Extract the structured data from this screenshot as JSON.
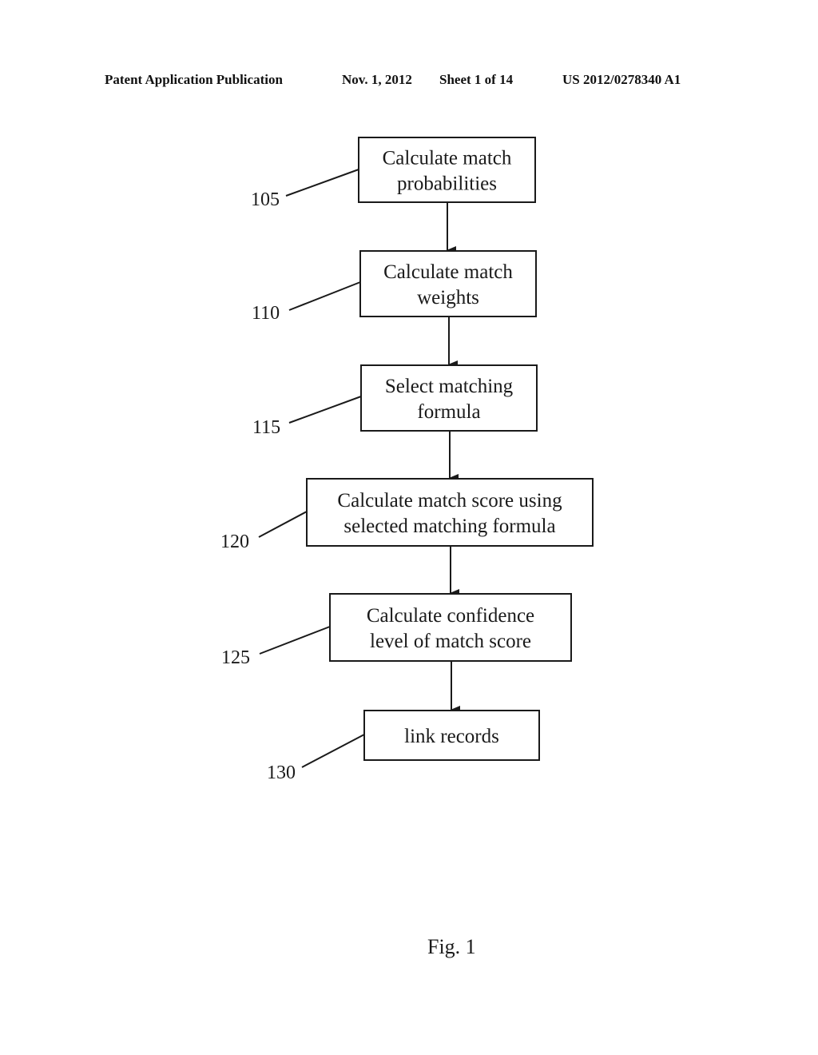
{
  "header": {
    "publication_type": "Patent Application Publication",
    "date": "Nov. 1, 2012",
    "sheet": "Sheet 1 of 14",
    "publication_number": "US 2012/0278340 A1"
  },
  "flowchart": {
    "steps": [
      {
        "ref": "105",
        "lines": [
          "Calculate match",
          "probabilities"
        ]
      },
      {
        "ref": "110",
        "lines": [
          "Calculate match",
          "weights"
        ]
      },
      {
        "ref": "115",
        "lines": [
          "Select matching",
          "formula"
        ]
      },
      {
        "ref": "120",
        "lines": [
          "Calculate match score using",
          "selected matching formula"
        ]
      },
      {
        "ref": "125",
        "lines": [
          "Calculate confidence",
          "level of match score"
        ]
      },
      {
        "ref": "130",
        "lines": [
          "link records"
        ]
      }
    ]
  },
  "figure_label": "Fig. 1"
}
